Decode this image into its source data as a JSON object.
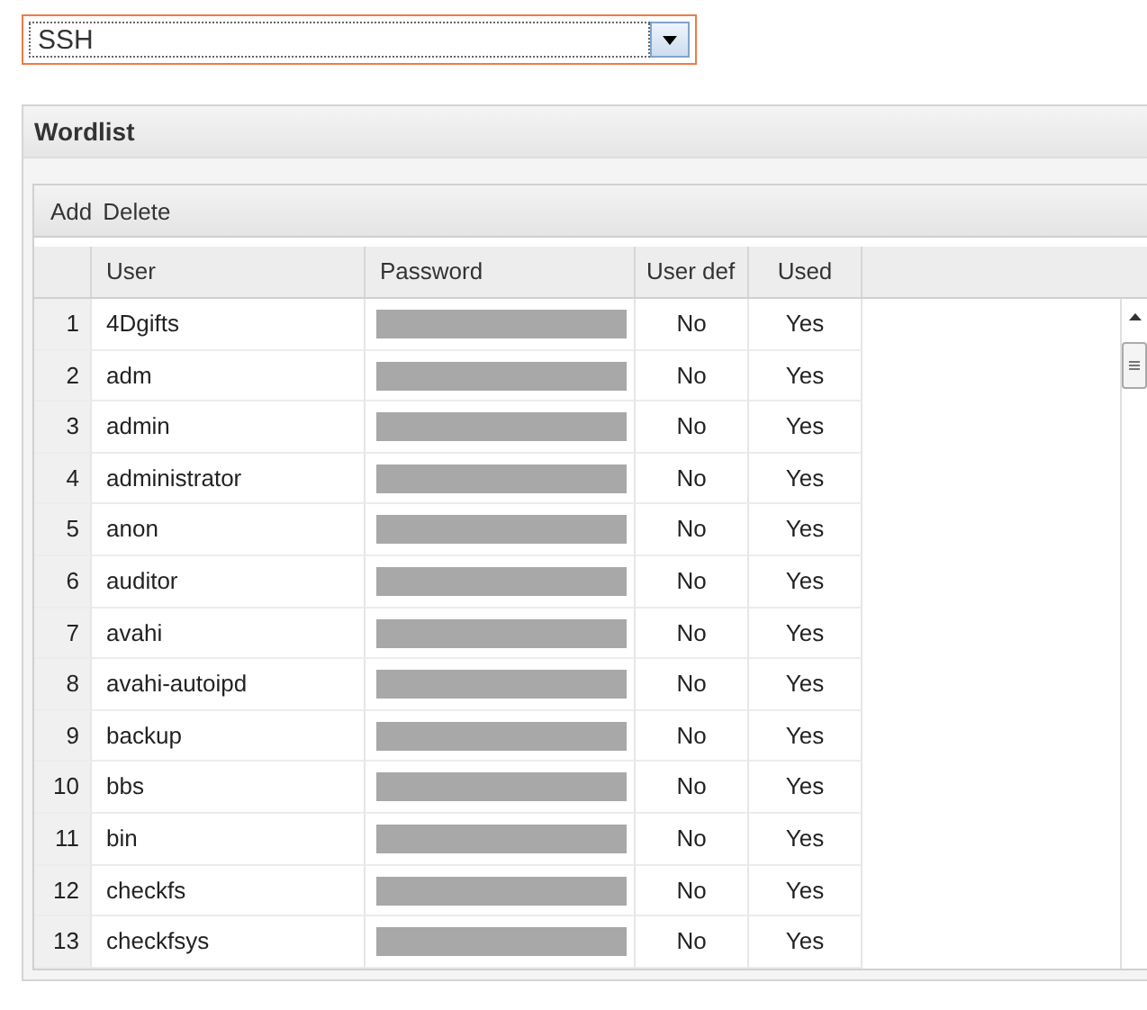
{
  "protocol_select": {
    "value": "SSH"
  },
  "panel": {
    "title": "Wordlist",
    "toolbar": [
      "Add",
      "Delete"
    ],
    "table": {
      "columns": [
        "User",
        "Password",
        "User def",
        "Used"
      ],
      "rows": [
        {
          "index": "1",
          "user": "4Dgifts",
          "user_def": "No",
          "used": "Yes"
        },
        {
          "index": "2",
          "user": "adm",
          "user_def": "No",
          "used": "Yes"
        },
        {
          "index": "3",
          "user": "admin",
          "user_def": "No",
          "used": "Yes"
        },
        {
          "index": "4",
          "user": "administrator",
          "user_def": "No",
          "used": "Yes"
        },
        {
          "index": "5",
          "user": "anon",
          "user_def": "No",
          "used": "Yes"
        },
        {
          "index": "6",
          "user": "auditor",
          "user_def": "No",
          "used": "Yes"
        },
        {
          "index": "7",
          "user": "avahi",
          "user_def": "No",
          "used": "Yes"
        },
        {
          "index": "8",
          "user": "avahi-autoipd",
          "user_def": "No",
          "used": "Yes"
        },
        {
          "index": "9",
          "user": "backup",
          "user_def": "No",
          "used": "Yes"
        },
        {
          "index": "10",
          "user": "bbs",
          "user_def": "No",
          "used": "Yes"
        },
        {
          "index": "11",
          "user": "bin",
          "user_def": "No",
          "used": "Yes"
        },
        {
          "index": "12",
          "user": "checkfs",
          "user_def": "No",
          "used": "Yes"
        },
        {
          "index": "13",
          "user": "checkfsys",
          "user_def": "No",
          "used": "Yes"
        }
      ]
    }
  }
}
